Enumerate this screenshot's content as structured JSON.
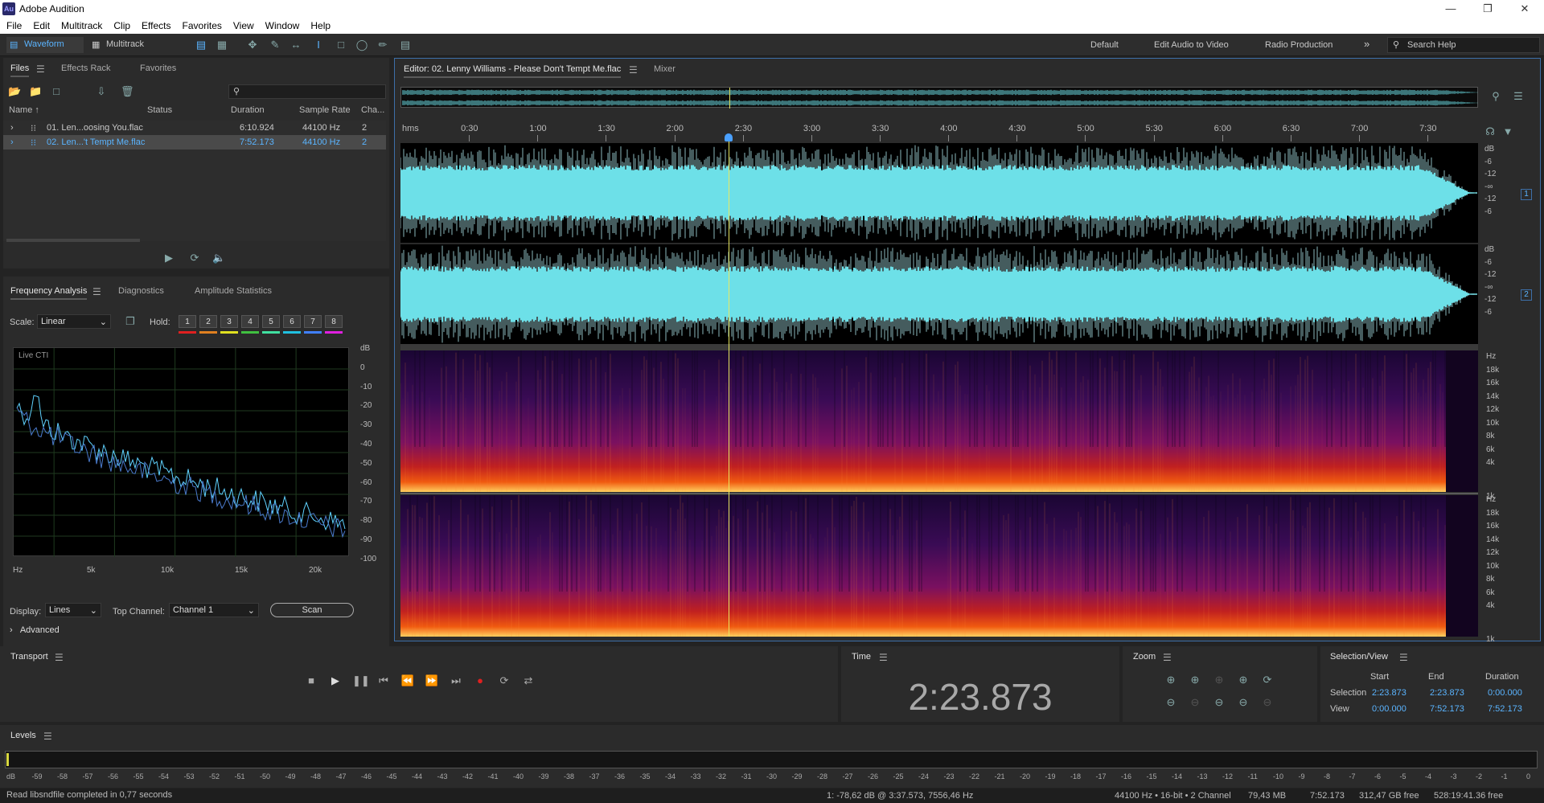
{
  "window": {
    "title": "Adobe Audition",
    "logo": "Au"
  },
  "menu": [
    "File",
    "Edit",
    "Multitrack",
    "Clip",
    "Effects",
    "Favorites",
    "View",
    "Window",
    "Help"
  ],
  "toolbar": {
    "waveform_label": "Waveform",
    "multitrack_label": "Multitrack",
    "workspaces": [
      "Default",
      "Edit Audio to Video",
      "Radio Production"
    ],
    "more": "»",
    "search_placeholder": "Search Help"
  },
  "files_panel": {
    "tabs": [
      "Files",
      "Effects Rack",
      "Favorites"
    ],
    "columns": [
      "Name ↑",
      "Status",
      "Duration",
      "Sample Rate",
      "Cha..."
    ],
    "rows": [
      {
        "name": "01. Len...oosing You.flac",
        "duration": "6:10.924",
        "rate": "44100 Hz",
        "ch": "2",
        "selected": false
      },
      {
        "name": "02. Len...'t Tempt Me.flac",
        "duration": "7:52.173",
        "rate": "44100 Hz",
        "ch": "2",
        "selected": true
      }
    ]
  },
  "freq_panel": {
    "tabs": [
      "Frequency Analysis",
      "Diagnostics",
      "Amplitude Statistics"
    ],
    "scale_label": "Scale:",
    "scale_value": "Linear",
    "hold_label": "Hold:",
    "hold_buttons": [
      "1",
      "2",
      "3",
      "4",
      "5",
      "6",
      "7",
      "8"
    ],
    "hold_colors": [
      "#e02020",
      "#e08020",
      "#e0e020",
      "#40c040",
      "#40e0a0",
      "#20c0e0",
      "#4080ff",
      "#e020e0"
    ],
    "graph_label": "Live CTI",
    "db_ticks": [
      "dB",
      "0",
      "-10",
      "-20",
      "-30",
      "-40",
      "-50",
      "-60",
      "-70",
      "-80",
      "-90",
      "-100"
    ],
    "hz_ticks": [
      "Hz",
      "5k",
      "10k",
      "15k",
      "20k"
    ],
    "display_label": "Display:",
    "display_value": "Lines",
    "top_channel_label": "Top Channel:",
    "top_channel_value": "Channel 1",
    "scan_label": "Scan",
    "advanced_label": "Advanced"
  },
  "editor": {
    "tab_title": "Editor: 02. Lenny Williams - Please Don't Tempt Me.flac",
    "mixer_tab": "Mixer",
    "ruler_labels": [
      "hms",
      "0:30",
      "1:00",
      "1:30",
      "2:00",
      "2:30",
      "3:00",
      "3:30",
      "4:00",
      "4:30",
      "5:00",
      "5:30",
      "6:00",
      "6:30",
      "7:00",
      "7:30"
    ],
    "wave_db_ticks": [
      "dB",
      "-6",
      "-12",
      "-∞",
      "-12",
      "-6"
    ],
    "channel_badges": [
      "1",
      "2"
    ],
    "spec_hz_ticks": [
      "Hz",
      "18k",
      "16k",
      "14k",
      "12k",
      "10k",
      "8k",
      "6k",
      "4k",
      "1k"
    ],
    "playhead_fraction": 0.3048,
    "wave_color": "#6de0e8",
    "playhead_color": "#e8e860"
  },
  "transport": {
    "title": "Transport"
  },
  "time_panel": {
    "title": "Time",
    "value": "2:23.873"
  },
  "zoom_panel": {
    "title": "Zoom"
  },
  "selection_panel": {
    "title": "Selection/View",
    "headers": [
      "Start",
      "End",
      "Duration"
    ],
    "selection_label": "Selection",
    "selection": [
      "2:23.873",
      "2:23.873",
      "0:00.000"
    ],
    "view_label": "View",
    "view": [
      "0:00.000",
      "7:52.173",
      "7:52.173"
    ]
  },
  "levels": {
    "title": "Levels",
    "scale": [
      "dB",
      "-59",
      "-58",
      "-57",
      "-56",
      "-55",
      "-54",
      "-53",
      "-52",
      "-51",
      "-50",
      "-49",
      "-48",
      "-47",
      "-46",
      "-45",
      "-44",
      "-43",
      "-42",
      "-41",
      "-40",
      "-39",
      "-38",
      "-37",
      "-36",
      "-35",
      "-34",
      "-33",
      "-32",
      "-31",
      "-30",
      "-29",
      "-28",
      "-27",
      "-26",
      "-25",
      "-24",
      "-23",
      "-22",
      "-21",
      "-20",
      "-19",
      "-18",
      "-17",
      "-16",
      "-15",
      "-14",
      "-13",
      "-12",
      "-11",
      "-10",
      "-9",
      "-8",
      "-7",
      "-6",
      "-5",
      "-4",
      "-3",
      "-2",
      "-1",
      "0"
    ]
  },
  "status": {
    "message": "Read libsndfile completed in 0,77 seconds",
    "cursor": "1: -78,62 dB @ 3:37.573, 7556,46 Hz",
    "format": "44100 Hz • 16-bit • 2 Channel",
    "size": "79,43 MB",
    "duration": "7:52.173",
    "free": "312,47 GB free",
    "free_time": "528:19:41.36 free"
  }
}
